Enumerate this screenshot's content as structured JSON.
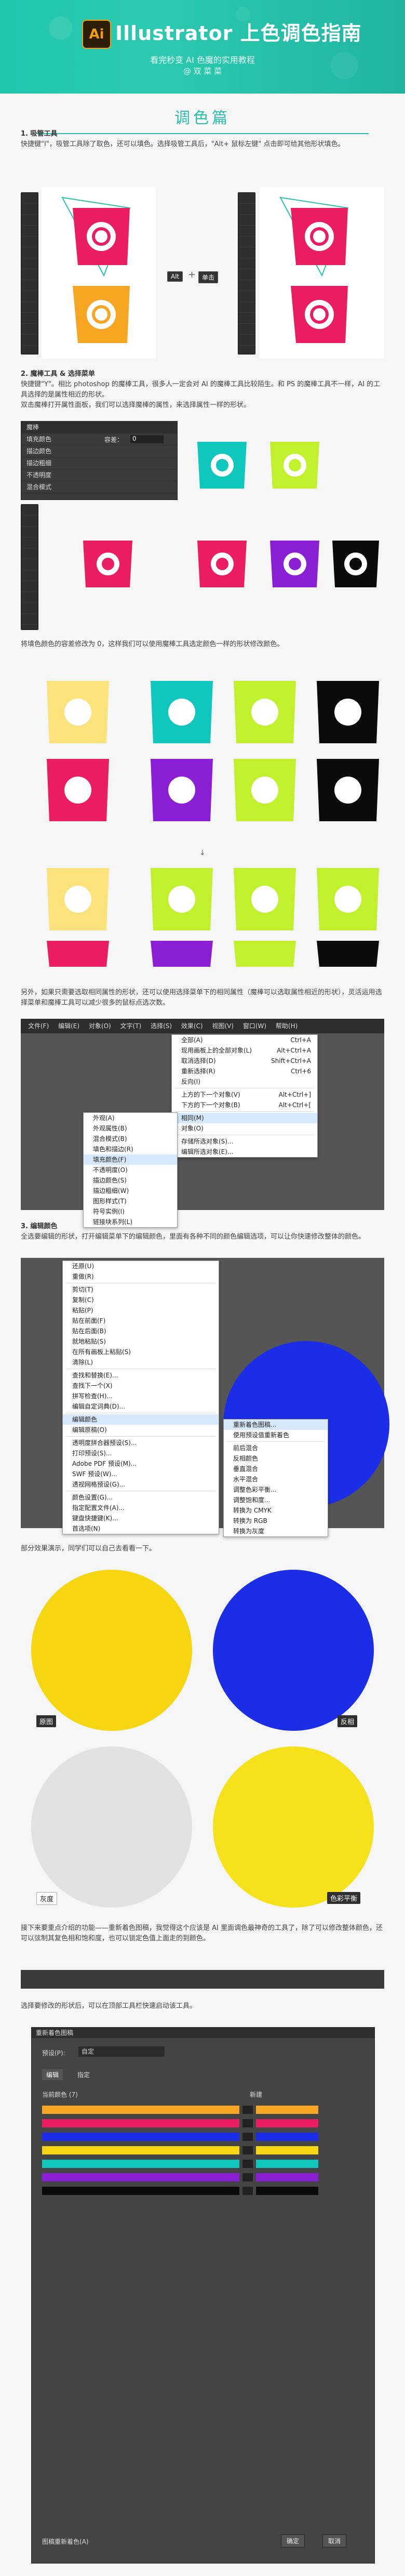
{
  "header": {
    "logo_text": "Ai",
    "title": "Illustrator 上色调色指南",
    "subtitle": "看完秒变 AI 色魔的实用教程",
    "author": "@ 双 菜 菜"
  },
  "section": {
    "title": "调色篇"
  },
  "steps": {
    "step1_title": "1. 吸管工具",
    "step1_desc": "快捷键\"I\"，吸管工具除了取色，还可以填色。选择吸管工具后，\"Alt+ 鼠标左键\" 点击即可给其他形状填色。",
    "shortcut_alt": "Alt",
    "shortcut_plus": "+",
    "shortcut_click": "单击",
    "step2_title": "2. 魔棒工具 & 选择菜单",
    "step2_desc": "快捷键\"Y\"。相比 photoshop 的魔棒工具，很多人一定会对 AI 的魔棒工具比较陌生。和 PS 的魔棒工具不一样，AI 的工具选择的是属性相近的形状。",
    "step2_desc2": "双击魔棒打开属性面板，我们可以选择魔棒的属性，来选择属性一样的形状。",
    "step2_desc3": "将填色颜色的容差修改为 0，这样我们可以使用魔棒工具选定颜色一样的形状修改颜色。",
    "step2_desc4": "另外，如果只需要选取相同属性的形状，还可以使用选择菜单下的相同属性（魔棒可以选取属性相近的形状），灵活运用选择菜单和魔棒工具可以减少很多的鼠标点选次数。",
    "step3_title": "3. 编辑颜色",
    "step3_desc": "全选要编辑的形状，打开编辑菜单下的编辑颜色，里面有各种不同的颜色编辑选项，可以让你快速修改整体的颜色。",
    "step3_desc2": "部分效果演示，同学们可以自己去看看一下。",
    "step3_desc3": "接下来要重点介绍的功能——重新着色图稿，我觉得这个应该是 AI 里面调色最神奇的工具了，除了可以修改整体颜色，还可以弦制其复色相和饱和度，也可以锁定色值上面走的到颜色。",
    "step3_desc4": "选择要修改的形状后，可以在顶部工具栏快速启动该工具。"
  },
  "magic_wand_panel": {
    "title": "魔棒",
    "rows": [
      "填充颜色",
      "描边颜色",
      "描边粗细",
      "不透明度",
      "混合模式"
    ],
    "tolerance_label": "容差：",
    "tolerance_value": "0"
  },
  "select_menu": {
    "bar": [
      "文件(F)",
      "编辑(E)",
      "对象(O)",
      "文字(T)",
      "选择(S)",
      "效果(C)",
      "视图(V)",
      "窗口(W)",
      "帮助(H)"
    ],
    "items": [
      {
        "label": "全部(A)",
        "key": "Ctrl+A"
      },
      {
        "label": "现用画板上的全部对象(L)",
        "key": "Alt+Ctrl+A"
      },
      {
        "label": "取消选择(D)",
        "key": "Shift+Ctrl+A"
      },
      {
        "label": "重新选择(R)",
        "key": "Ctrl+6"
      },
      {
        "label": "反向(I)",
        "key": ""
      },
      {
        "label": "上方的下一个对象(V)",
        "key": "Alt+Ctrl+]"
      },
      {
        "label": "下方的下一个对象(B)",
        "key": "Alt+Ctrl+["
      },
      {
        "label": "相同(M)",
        "key": ""
      },
      {
        "label": "对象(O)",
        "key": ""
      },
      {
        "label": "存储所选对象(S)...",
        "key": ""
      },
      {
        "label": "编辑所选对象(E)...",
        "key": ""
      }
    ],
    "submenu": [
      "外观(A)",
      "外观属性(B)",
      "混合模式(B)",
      "填色和描边(R)",
      "填充颜色(F)",
      "不透明度(O)",
      "描边颜色(S)",
      "描边粗细(W)",
      "图形样式(T)",
      "符号实例(I)",
      "链接块系列(L)"
    ]
  },
  "edit_menu": {
    "items": [
      "还原(U)",
      "重做(R)",
      "剪切(T)",
      "复制(C)",
      "粘贴(P)",
      "贴在前面(F)",
      "贴在后面(B)",
      "就地粘贴(S)",
      "在所有画板上粘贴(S)",
      "清除(L)",
      "查找和替换(E)...",
      "查找下一个(X)",
      "拼写检查(H)...",
      "编辑自定词典(D)...",
      "编辑颜色",
      "编辑原稿(O)",
      "透明度拼合器预设(S)...",
      "打印预设(S)...",
      "Adobe PDF 预设(M)...",
      "SWF 预设(W)...",
      "透视网格预设(G)...",
      "颜色设置(G)...",
      "指定配置文件(A)...",
      "键盘快捷键(K)...",
      "首选项(N)"
    ],
    "submenu": [
      "重新着色图稿...",
      "使用预设值重新着色",
      "前后混合",
      "反相颜色",
      "垂直混合",
      "水平混合",
      "调整色彩平衡...",
      "调整饱和度...",
      "转换为 CMYK",
      "转换为 RGB",
      "转换为灰度"
    ]
  },
  "demo_labels": {
    "original": "原图",
    "invert": "反相",
    "gray": "灰度",
    "balance": "色彩平衡"
  },
  "recolor_window": {
    "title": "重新着色图稿",
    "tab_edit": "编辑",
    "tab_assign": "指定",
    "preset_label": "预设(P):",
    "preset_value": "自定",
    "current_colors": "当前颜色 (7)",
    "new": "新建",
    "ok": "确定",
    "cancel": "取消",
    "recolor_check": "图稿重新着色(A)"
  },
  "palette": {
    "magenta": "#ea1d63",
    "teal": "#10c7bd",
    "purple": "#8b1fd6",
    "yellow": "#fbe27a",
    "lime": "#c1f02d",
    "black": "#0b0b0b",
    "orange": "#f6a623",
    "accent": "#27c1aa",
    "blue": "#1b2de6",
    "gold": "#f6d611"
  }
}
